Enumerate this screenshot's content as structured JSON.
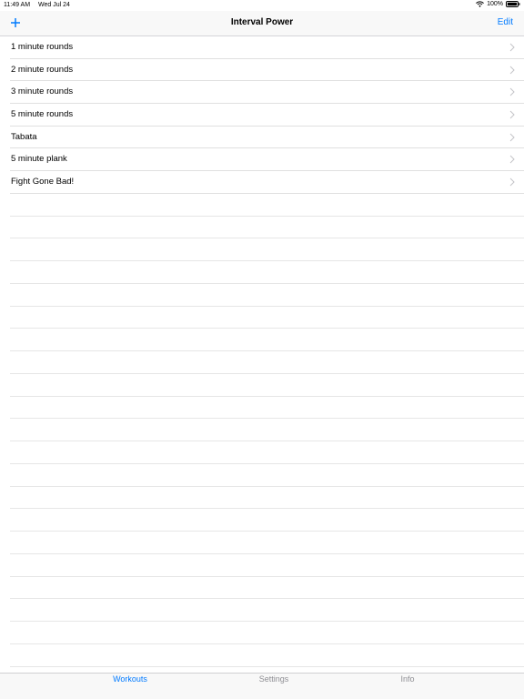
{
  "status": {
    "time": "11:49 AM",
    "date": "Wed Jul 24",
    "battery": "100%",
    "wifi_icon": "wifi-icon",
    "battery_icon": "battery-icon"
  },
  "nav": {
    "title": "Interval Power",
    "add_icon": "plus-icon",
    "edit_label": "Edit",
    "accent": "#007aff"
  },
  "workouts": [
    {
      "label": "1 minute rounds"
    },
    {
      "label": "2 minute rounds"
    },
    {
      "label": "3 minute rounds"
    },
    {
      "label": "5 minute rounds"
    },
    {
      "label": "Tabata"
    },
    {
      "label": "5 minute plank"
    },
    {
      "label": "Fight Gone Bad!"
    }
  ],
  "tabs": {
    "workouts": "Workouts",
    "settings": "Settings",
    "info": "Info",
    "active": "Workouts",
    "active_color": "#007aff",
    "inactive_color": "#8e8e93"
  }
}
